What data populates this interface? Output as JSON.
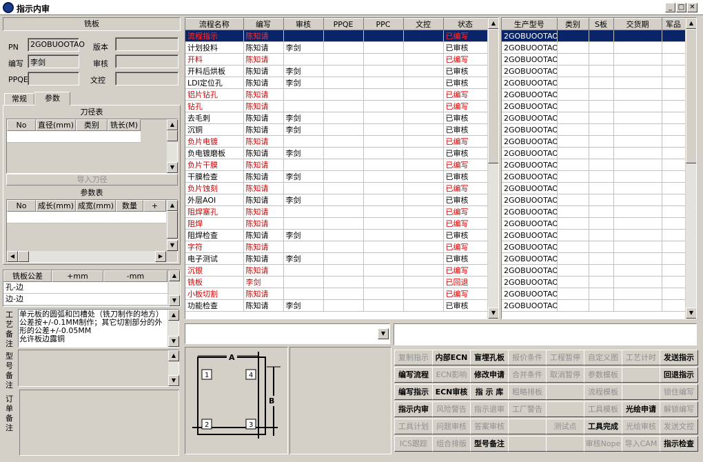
{
  "window": {
    "title": "指示内审",
    "min": "_",
    "max": "□",
    "close": "✕"
  },
  "left": {
    "section_title": "铣板",
    "fields": {
      "pn_label": "PN",
      "pn_value": "2GOBUOOTAO",
      "version_label": "版本",
      "version_value": "",
      "editor_label": "编写",
      "editor_value": "李剑",
      "review_label": "审核",
      "review_value": "",
      "ppqe_label": "PPQE",
      "ppqe_value": "",
      "doc_label": "文控",
      "doc_value": ""
    },
    "tabs": [
      "常规",
      "参数"
    ],
    "tool_table": {
      "title": "刀径表",
      "headers": [
        "No",
        "直径(mm)",
        "类别",
        "铣长(M)"
      ],
      "import_button": "导入刀径"
    },
    "param_table": {
      "title": "参数表",
      "headers": [
        "No",
        "成长(mm)",
        "成宽(mm)",
        "数量",
        "+"
      ]
    },
    "tolerance": {
      "headers": [
        "铣板公差",
        "+mm",
        "-mm"
      ],
      "rows": [
        "孔-边",
        "边-边"
      ]
    },
    "process_note_label": "工艺备注",
    "process_note": "单元板的圆弧和凹槽处（铣刀制作的地方）公差按+/-0.1MM制作；其它切割部分的外形的公差+/-0.05MM\n允许板边露铜",
    "model_note_label": "型号备注",
    "order_note_label": "订单备注"
  },
  "flow": {
    "headers": [
      "流程名称",
      "编写",
      "审核",
      "PPQE",
      "PPC",
      "文控",
      "状态"
    ],
    "rows": [
      {
        "name": "流程指示",
        "editor": "陈知请",
        "reviewer": "",
        "status": "已编写",
        "red": true,
        "selected": true
      },
      {
        "name": "计划投料",
        "editor": "陈知请",
        "reviewer": "李剑",
        "status": "已审核",
        "red": false
      },
      {
        "name": "开料",
        "editor": "陈知请",
        "reviewer": "",
        "status": "已编写",
        "red": true
      },
      {
        "name": "开料后烘板",
        "editor": "陈知请",
        "reviewer": "李剑",
        "status": "已审核",
        "red": false
      },
      {
        "name": "LDI定位孔",
        "editor": "陈知请",
        "reviewer": "李剑",
        "status": "已审核",
        "red": false
      },
      {
        "name": "铝片钻孔",
        "editor": "陈知请",
        "reviewer": "",
        "status": "已编写",
        "red": true
      },
      {
        "name": "钻孔",
        "editor": "陈知请",
        "reviewer": "",
        "status": "已编写",
        "red": true
      },
      {
        "name": "去毛刺",
        "editor": "陈知请",
        "reviewer": "李剑",
        "status": "已审核",
        "red": false
      },
      {
        "name": "沉铜",
        "editor": "陈知请",
        "reviewer": "李剑",
        "status": "已审核",
        "red": false
      },
      {
        "name": "负片电镀",
        "editor": "陈知请",
        "reviewer": "",
        "status": "已编写",
        "red": true
      },
      {
        "name": "负电镀磨板",
        "editor": "陈知请",
        "reviewer": "李剑",
        "status": "已审核",
        "red": false
      },
      {
        "name": "负片干膜",
        "editor": "陈知请",
        "reviewer": "",
        "status": "已编写",
        "red": true
      },
      {
        "name": "干膜检查",
        "editor": "陈知请",
        "reviewer": "李剑",
        "status": "已审核",
        "red": false
      },
      {
        "name": "负片蚀刻",
        "editor": "陈知请",
        "reviewer": "",
        "status": "已编写",
        "red": true
      },
      {
        "name": "外层AOI",
        "editor": "陈知请",
        "reviewer": "李剑",
        "status": "已审核",
        "red": false
      },
      {
        "name": "阻焊塞孔",
        "editor": "陈知请",
        "reviewer": "",
        "status": "已编写",
        "red": true
      },
      {
        "name": "阻焊",
        "editor": "陈知请",
        "reviewer": "",
        "status": "已编写",
        "red": true
      },
      {
        "name": "阻焊检查",
        "editor": "陈知请",
        "reviewer": "李剑",
        "status": "已审核",
        "red": false
      },
      {
        "name": "字符",
        "editor": "陈知请",
        "reviewer": "",
        "status": "已编写",
        "red": true
      },
      {
        "name": "电子测试",
        "editor": "陈知请",
        "reviewer": "李剑",
        "status": "已审核",
        "red": false
      },
      {
        "name": "沉银",
        "editor": "陈知请",
        "reviewer": "",
        "status": "已编写",
        "red": true
      },
      {
        "name": "铣板",
        "editor": "李剑",
        "reviewer": "",
        "status": "已回退",
        "red": true
      },
      {
        "name": "小板切割",
        "editor": "陈知请",
        "reviewer": "",
        "status": "已编写",
        "red": true
      },
      {
        "name": "功能检查",
        "editor": "陈知请",
        "reviewer": "李剑",
        "status": "已审核",
        "red": false
      }
    ]
  },
  "models": {
    "headers": [
      "生产型号",
      "类别",
      "S板",
      "交货期",
      "军品"
    ],
    "value": "2GOBUOOTAO",
    "count": 24
  },
  "diagram": {
    "a": "A",
    "b": "B",
    "n1": "1",
    "n2": "2",
    "n3": "3",
    "n4": "4"
  },
  "actions": [
    [
      "复制指示",
      "内部ECN",
      "盲埋孔板",
      "报价条件",
      "工程暂停",
      "自定义图",
      "工艺计时",
      "发送指示"
    ],
    [
      "编写流程",
      "ECN影响",
      "修改申请",
      "合并条件",
      "取消暂停",
      "参数模板",
      "",
      "回退指示"
    ],
    [
      "编写指示",
      "ECN审核",
      "指 示 库",
      "粗略排板",
      "",
      "流程模板",
      "",
      "锁住编写"
    ],
    [
      "指示内审",
      "风险警告",
      "指示退审",
      "工厂警告",
      "",
      "工具模板",
      "光绘申请",
      "解锁编写"
    ],
    [
      "工具计划",
      "问题审核",
      "答案审核",
      "",
      "测试点",
      "工具完成",
      "光绘审核",
      "发送文控"
    ],
    [
      "ICS跟踪",
      "组合排版",
      "型号备注",
      "",
      "",
      "审核Nope",
      "导入CAM",
      "指示检查"
    ]
  ],
  "actions_enabled": [
    [
      false,
      true,
      true,
      false,
      false,
      false,
      false,
      true
    ],
    [
      true,
      false,
      true,
      false,
      false,
      false,
      false,
      true
    ],
    [
      true,
      true,
      true,
      false,
      false,
      false,
      false,
      false
    ],
    [
      true,
      false,
      false,
      false,
      false,
      false,
      true,
      false
    ],
    [
      false,
      false,
      false,
      false,
      false,
      true,
      false,
      false
    ],
    [
      false,
      false,
      true,
      false,
      false,
      false,
      false,
      true
    ]
  ]
}
